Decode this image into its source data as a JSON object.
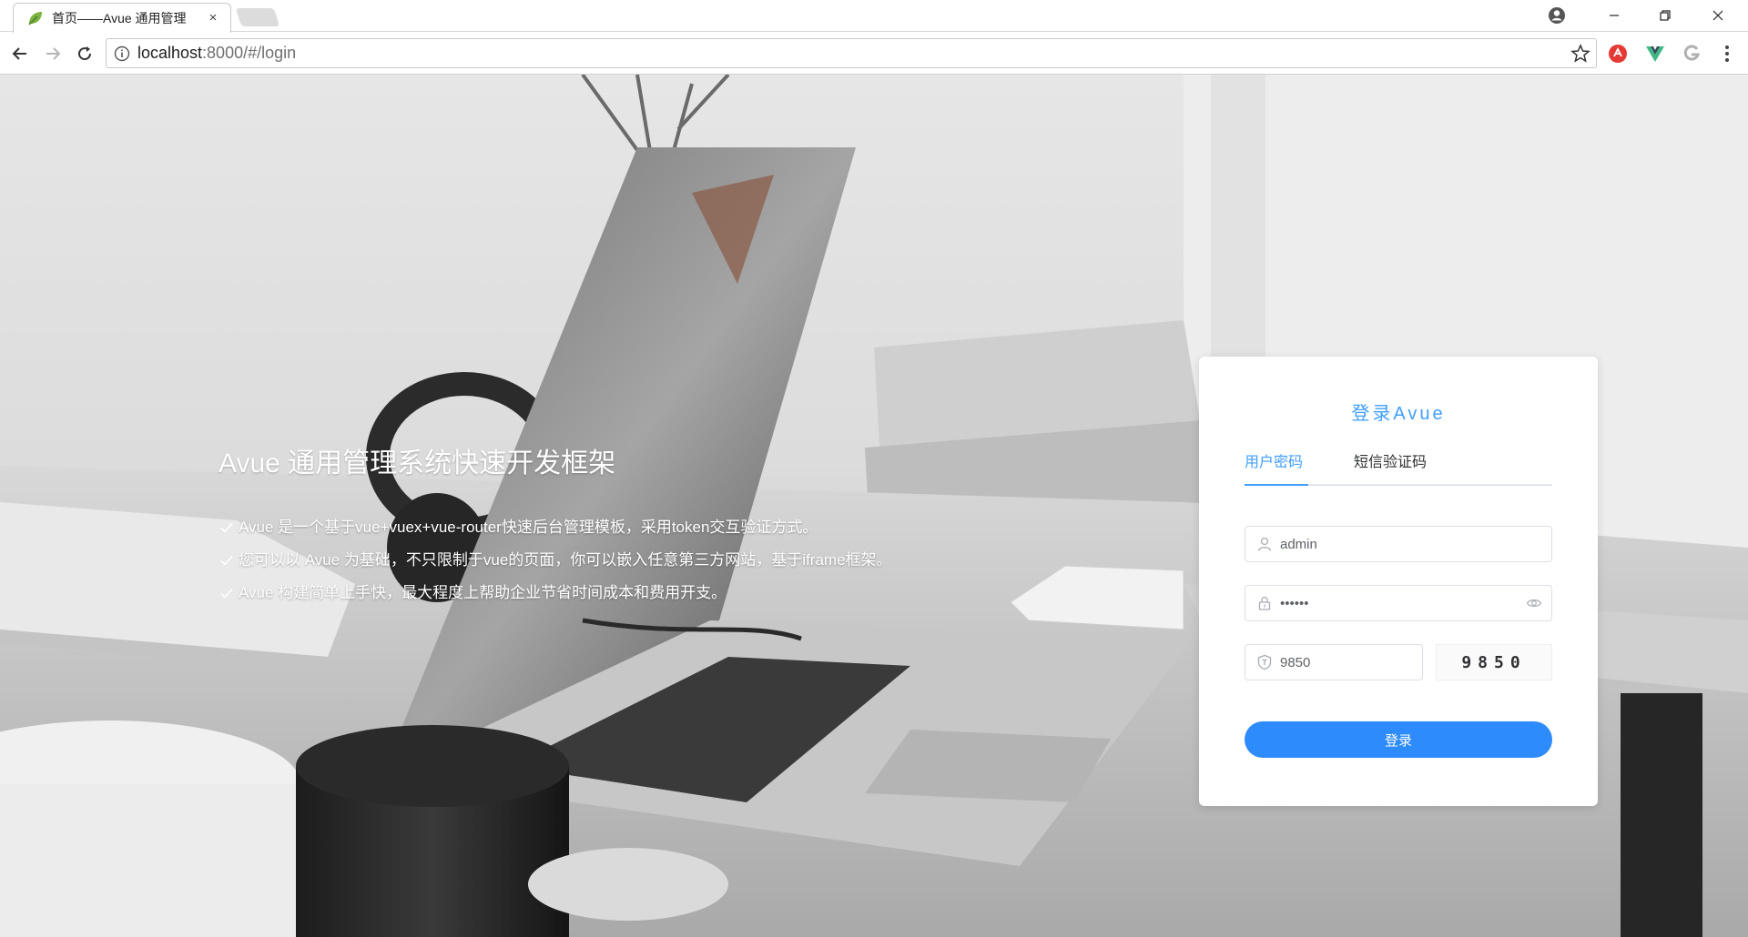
{
  "browser": {
    "tab_title": "首页——Avue 通用管理",
    "tab_close": "×",
    "url_host": "localhost",
    "url_rest": ":8000/#/login",
    "window_controls": [
      "minimize-icon",
      "restore-icon",
      "close-icon"
    ],
    "extensions": [
      "adblock-icon",
      "vue-devtools-icon",
      "g-extension-icon"
    ]
  },
  "hero": {
    "title": "Avue 通用管理系统快速开发框架",
    "items": [
      "Avue 是一个基于vue+vuex+vue-router快速后台管理模板，采用token交互验证方式。",
      "您可以以 Avue 为基础，不只限制于vue的页面，你可以嵌入任意第三方网站，基于iframe框架。",
      "Avue 构建简单上手快，最大程度上帮助企业节省时间成本和费用开支。"
    ]
  },
  "login": {
    "title": "登录Avue",
    "tabs": [
      "用户密码",
      "短信验证码"
    ],
    "active_tab": 0,
    "username": "admin",
    "password": "••••••",
    "code_value": "9850",
    "captcha": "9850",
    "submit_label": "登录"
  },
  "colors": {
    "accent": "#409eff",
    "button": "#2e8bfb"
  }
}
